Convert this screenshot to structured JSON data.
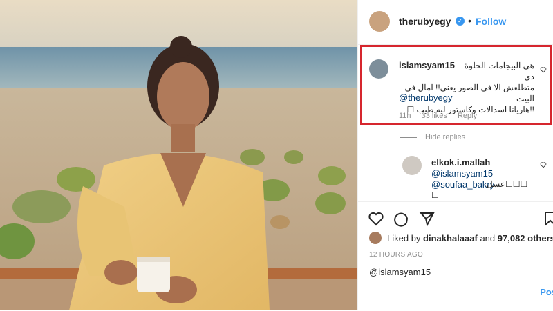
{
  "post": {
    "username": "therubyegy",
    "separator": "•",
    "follow_label": "Follow",
    "verified_icon": "verified-badge-icon",
    "time_ago": "12 HOURS AGO"
  },
  "highlighted_comment": {
    "username": "islamsyam15",
    "text_line1": "هي البيجامات الحلوة دي",
    "text_line2": "متطلعش الا في الصور يعني!! امال في البيت",
    "text_line3": "!!هاريانا اسدالات وكاستور ليه طيب ☐",
    "mention": "@therubyegy",
    "time": "11h",
    "likes": "33 likes",
    "reply_label": "Reply",
    "highlight_color": "#d6262e"
  },
  "hide_replies_label": "Hide replies",
  "reply": {
    "username": "elkok.i.mallah",
    "mention1": "@islamsyam15",
    "mention2": "@soufaa_bakry",
    "tail": "عسل☐☐☐",
    "tail2": "☐"
  },
  "likes": {
    "prefix": "Liked by",
    "user": "dinakhalaaaf",
    "middle": "and",
    "count": "97,082 others"
  },
  "comment_input": {
    "value": "@islamsyam15",
    "post_label": "Pos"
  },
  "colors": {
    "accent": "#3897f0",
    "highlight": "#d6262e",
    "text": "#262626",
    "muted": "#8e8e8e"
  }
}
